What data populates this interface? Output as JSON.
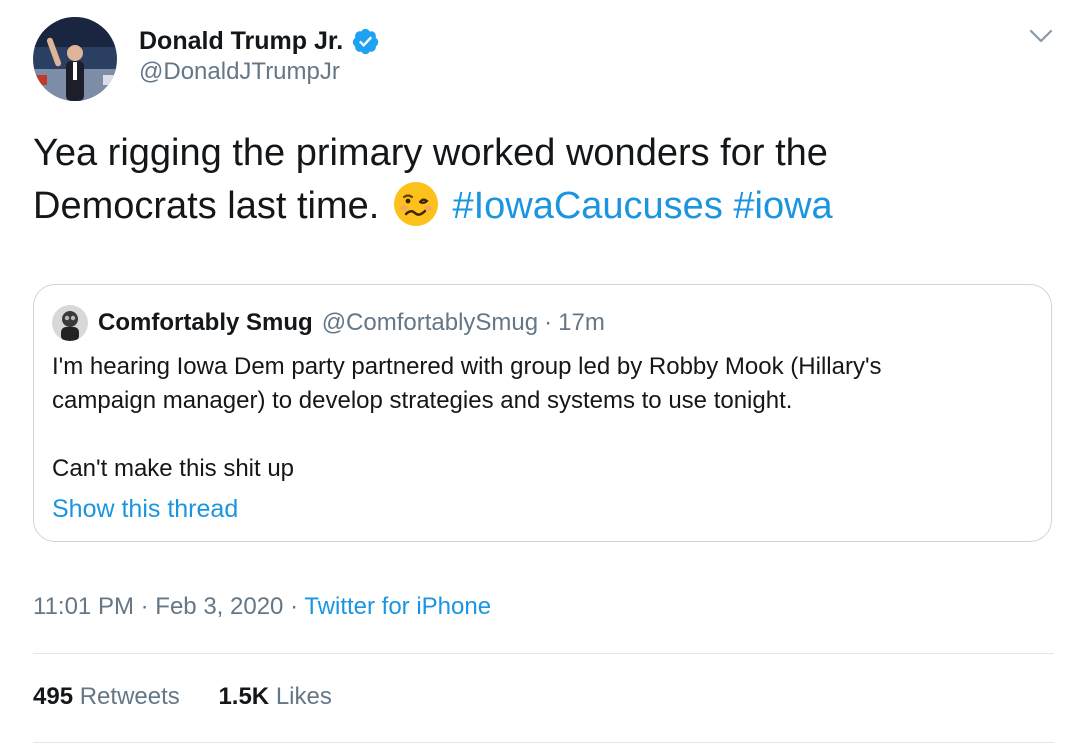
{
  "author": {
    "name": "Donald Trump Jr.",
    "handle": "@DonaldJTrumpJr"
  },
  "tweet": {
    "text_line1": "Yea rigging the primary worked wonders for the",
    "text_line2": "Democrats last time.",
    "emoji": "woozy-face-emoji",
    "hashtags": [
      "#IowaCaucuses",
      "#iowa"
    ]
  },
  "quote": {
    "name": "Comfortably Smug",
    "handle": "@ComfortablySmug",
    "separator": "·",
    "time": "17m",
    "line1": "I'm hearing Iowa Dem party partnered with group led by Robby Mook (Hillary's",
    "line2": "campaign manager) to develop strategies and systems to use tonight.",
    "line3": "Can't make this shit up",
    "show_thread": "Show this thread"
  },
  "meta": {
    "time": "11:01 PM",
    "sep1": "·",
    "date": "Feb 3, 2020",
    "sep2": "·",
    "source": "Twitter for iPhone"
  },
  "stats": {
    "retweets_count": "495",
    "retweets_label": "Retweets",
    "likes_count": "1.5K",
    "likes_label": "Likes"
  },
  "colors": {
    "link": "#1b95e0",
    "secondary_text": "#657786",
    "primary_text": "#14171a",
    "border": "#ccd6dd"
  }
}
